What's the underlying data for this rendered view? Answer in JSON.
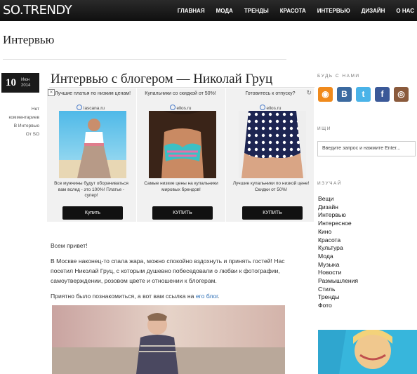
{
  "header": {
    "logo": "SO.TRENDY",
    "nav": [
      "ГЛАВНАЯ",
      "МОДА",
      "ТРЕНДЫ",
      "КРАСОТА",
      "ИНТЕРВЬЮ",
      "ДИЗАЙН",
      "О НАС"
    ]
  },
  "page_title": "Интервью",
  "post": {
    "date_day": "10",
    "date_month": "Июн",
    "date_year": "2014",
    "meta": [
      "Нет",
      "комментариев",
      "В Интервью",
      "От SO"
    ],
    "title": "Интервью с блогером — Николай Груц",
    "paragraphs": [
      "Всем привет!",
      "В Москве наконец-то спала жара, можно спокойно вздохнуть и принять гостей! Нас посетил Николай Груц, с которым душевно побеседовали о любви к фотографии, самоутверждении, розовом цвете и отношении к блогерам.",
      "Приятно было познакомиться, а вот вам ссылка на "
    ],
    "link_text": "его блог",
    "link_suffix": "."
  },
  "ads": [
    {
      "headline": "Лучшие платья по низким ценам!",
      "domain": "lascana.ru",
      "desc": "Все мужчины будут оборачиваться вам вслед - это 100%! Платье - супер!",
      "button": "Купить"
    },
    {
      "headline": "Купальники со скидкой от 50%!",
      "domain": "ellos.ru",
      "desc": "Самые низкие цены на купальники мировых брендов!",
      "button": "КУПИТЬ"
    },
    {
      "headline": "Готовитесь к отпуску?",
      "domain": "ellos.ru",
      "desc": "Лучшие купальники по низкой цене! Скидки от 50%!",
      "button": "КУПИТЬ"
    }
  ],
  "sidebar": {
    "social_heading": "БУДЬ С НАМИ",
    "social": [
      "rss-icon",
      "vk-icon",
      "twitter-icon",
      "facebook-icon",
      "instagram-icon"
    ],
    "search_heading": "ИЩИ",
    "search_placeholder": "Введите запрос и нажмите Enter...",
    "categories_heading": "ИЗУЧАЙ",
    "categories": [
      "Вещи",
      "Дизайн",
      "Интервью",
      "Интересное",
      "Кино",
      "Красота",
      "Культура",
      "Мода",
      "Музыка",
      "Новости",
      "Размышления",
      "Стиль",
      "Тренды",
      "Фото"
    ]
  },
  "colors": {
    "topbar": "#111111",
    "link": "#2a6db5",
    "ad_bg": "#f1f1f1"
  }
}
